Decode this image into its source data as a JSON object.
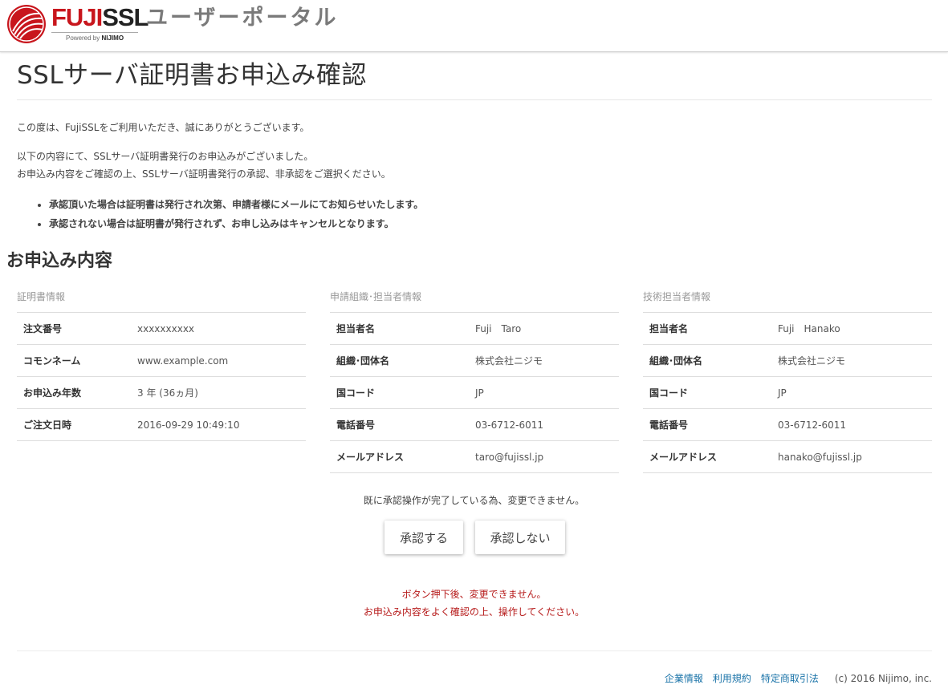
{
  "header": {
    "logo_fuji": "FUJI",
    "logo_ssl": "SSL",
    "powered_by_prefix": "Powered by",
    "powered_by_brand": "NIJIMO",
    "portal_title": "ユーザーポータル"
  },
  "page": {
    "title": "SSLサーバ証明書お申込み確認",
    "intro_1": "この度は、FujiSSLをご利用いただき、誠にありがとうございます。",
    "intro_2": "以下の内容にて、SSLサーバ証明書発行のお申込みがございました。",
    "intro_3": "お申込み内容をご確認の上、SSLサーバ証明書発行の承認、非承認をご選択ください。",
    "bullet_1": "承認頂いた場合は証明書は発行され次第、申請者様にメールにてお知らせいたします。",
    "bullet_2": "承認されない場合は証明書が発行されず、お申し込みはキャンセルとなります。",
    "section_title": "お申込み内容"
  },
  "certificate": {
    "caption": "証明書情報",
    "rows": [
      {
        "label": "注文番号",
        "value": "xxxxxxxxxx"
      },
      {
        "label": "コモンネーム",
        "value": "www.example.com"
      },
      {
        "label": "お申込み年数",
        "value": "3 年 (36ヵ月)"
      },
      {
        "label": "ご注文日時",
        "value": "2016-09-29 10:49:10"
      }
    ]
  },
  "applicant": {
    "caption": "申請組織･担当者情報",
    "rows": [
      {
        "label": "担当者名",
        "value": "Fuji　Taro"
      },
      {
        "label": "組織･団体名",
        "value": "株式会社ニジモ"
      },
      {
        "label": "国コード",
        "value": "JP"
      },
      {
        "label": "電話番号",
        "value": "03-6712-6011"
      },
      {
        "label": "メールアドレス",
        "value": "taro@fujissl.jp"
      }
    ]
  },
  "technical": {
    "caption": "技術担当者情報",
    "rows": [
      {
        "label": "担当者名",
        "value": "Fuji　Hanako"
      },
      {
        "label": "組織･団体名",
        "value": "株式会社ニジモ"
      },
      {
        "label": "国コード",
        "value": "JP"
      },
      {
        "label": "電話番号",
        "value": "03-6712-6011"
      },
      {
        "label": "メールアドレス",
        "value": "hanako@fujissl.jp"
      }
    ]
  },
  "actions": {
    "notice": "既に承認操作が完了している為、変更できません。",
    "approve_label": "承認する",
    "reject_label": "承認しない",
    "warning_1": "ボタン押下後、変更できません。",
    "warning_2": "お申込み内容をよく確認の上、操作してください。"
  },
  "footer": {
    "link_company": "企業情報",
    "link_terms": "利用規約",
    "link_law": "特定商取引法",
    "copyright": "(c) 2016 Nijimo, inc."
  },
  "colors": {
    "brand_red": "#c8161d",
    "warning_red": "#b71c1c",
    "link_blue": "#1a73a8"
  }
}
